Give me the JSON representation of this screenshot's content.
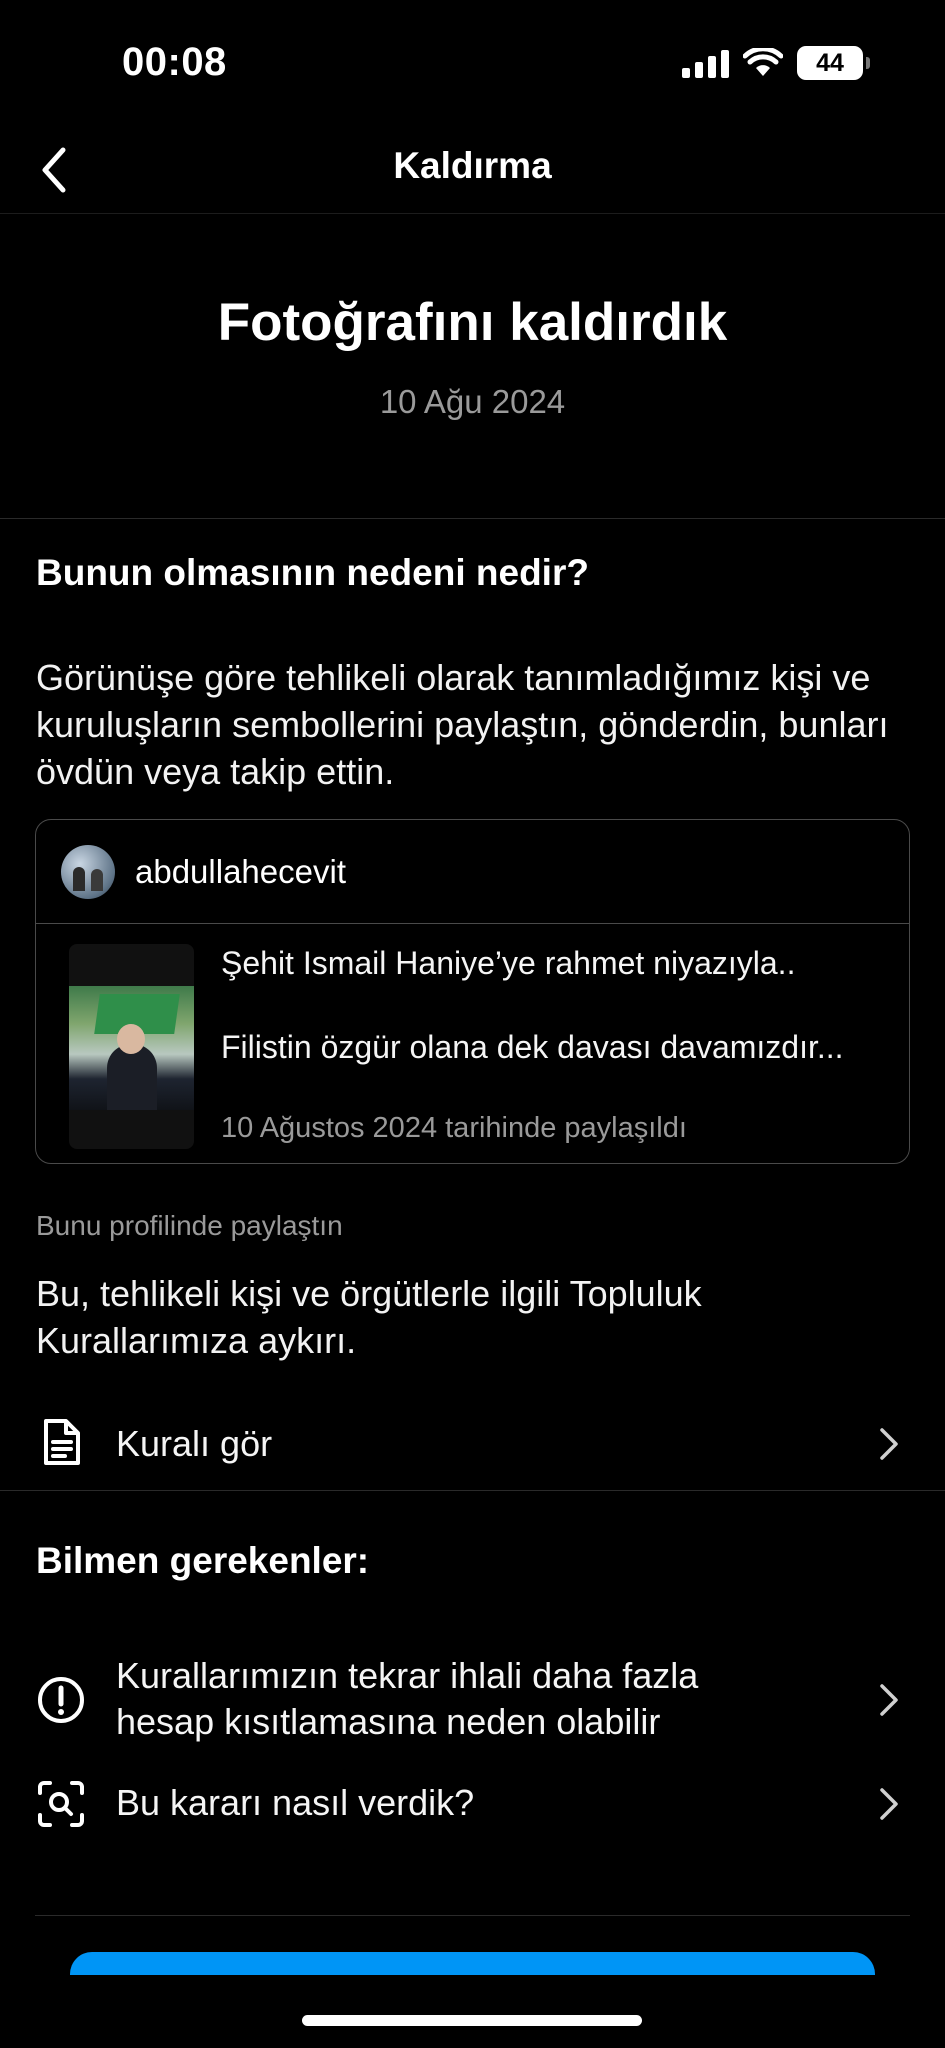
{
  "status_bar": {
    "time": "00:08",
    "battery": "44"
  },
  "nav": {
    "title": "Kaldırma"
  },
  "header": {
    "headline": "Fotoğrafını kaldırdık",
    "date": "10 Ağu 2024"
  },
  "reason": {
    "title": "Bunun olmasının nedeni nedir?",
    "description": "Görünüşe göre tehlikeli olarak tanımladığımız kişi ve kuruluşların sembollerini paylaştın, gönderdin, bunları övdün veya takip ettin."
  },
  "post": {
    "username": "abdullahecevit",
    "caption": "Şehit Ismail Haniye’ye rahmet niyazıyla..\n\nFilistin özgür olana dek davası davamızdır...",
    "shared_date": "10 Ağustos 2024 tarihinde paylaşıldı"
  },
  "shared_label": "Bunu profilinde paylaştın",
  "violation_text": "Bu, tehlikeli kişi ve örgütlerle ilgili Topluluk Kurallarımıza aykırı.",
  "see_rule": {
    "label": "Kuralı gör",
    "icon": "document-icon"
  },
  "know": {
    "title": "Bilmen gerekenler:",
    "items": [
      {
        "label": "Kurallarımızın tekrar ihlali daha fazla hesap kısıtlamasına neden olabilir",
        "icon": "alert-circle-icon"
      },
      {
        "label": "Bu kararı nasıl verdik?",
        "icon": "scan-search-icon"
      }
    ]
  },
  "colors": {
    "accent": "#0095f6",
    "background": "#000000",
    "muted": "#9a9a9a"
  }
}
